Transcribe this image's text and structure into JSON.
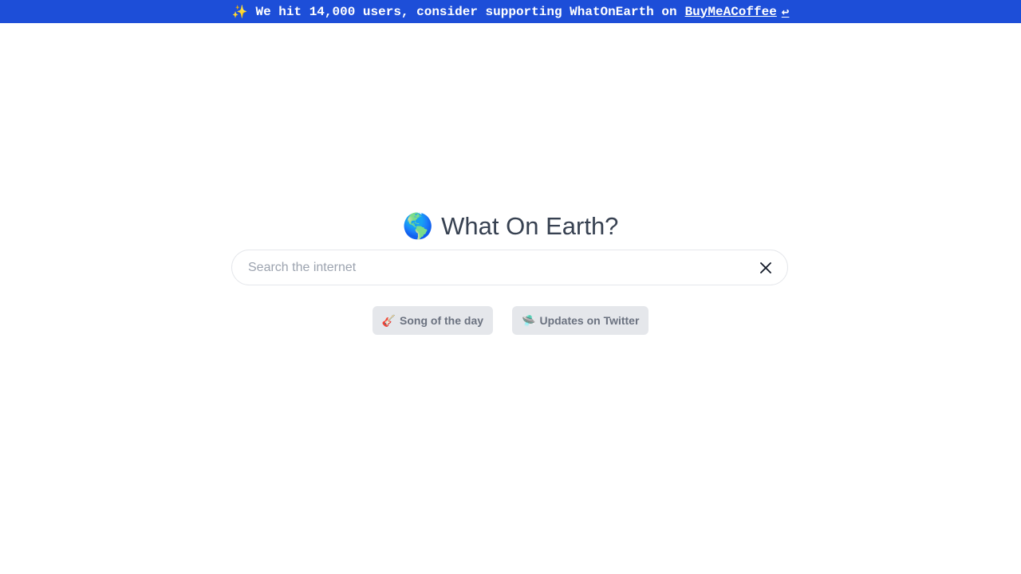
{
  "banner": {
    "sparkle": "✨",
    "text": "We hit 14,000 users, consider supporting WhatOnEarth on",
    "link_label": "BuyMeACoffee",
    "link_arrow": "↩"
  },
  "header": {
    "globe": "🌎",
    "title": "What On Earth?"
  },
  "search": {
    "placeholder": "Search the internet",
    "value": "",
    "clear_icon": "close-icon"
  },
  "actions": [
    {
      "emoji": "🎸",
      "label": "Song of the day"
    },
    {
      "emoji": "🛸",
      "label": "Updates on Twitter"
    }
  ],
  "colors": {
    "banner_bg": "#1d4ed8",
    "title": "#374151",
    "pill_bg": "#e5e7eb",
    "pill_text": "#6b7280"
  }
}
